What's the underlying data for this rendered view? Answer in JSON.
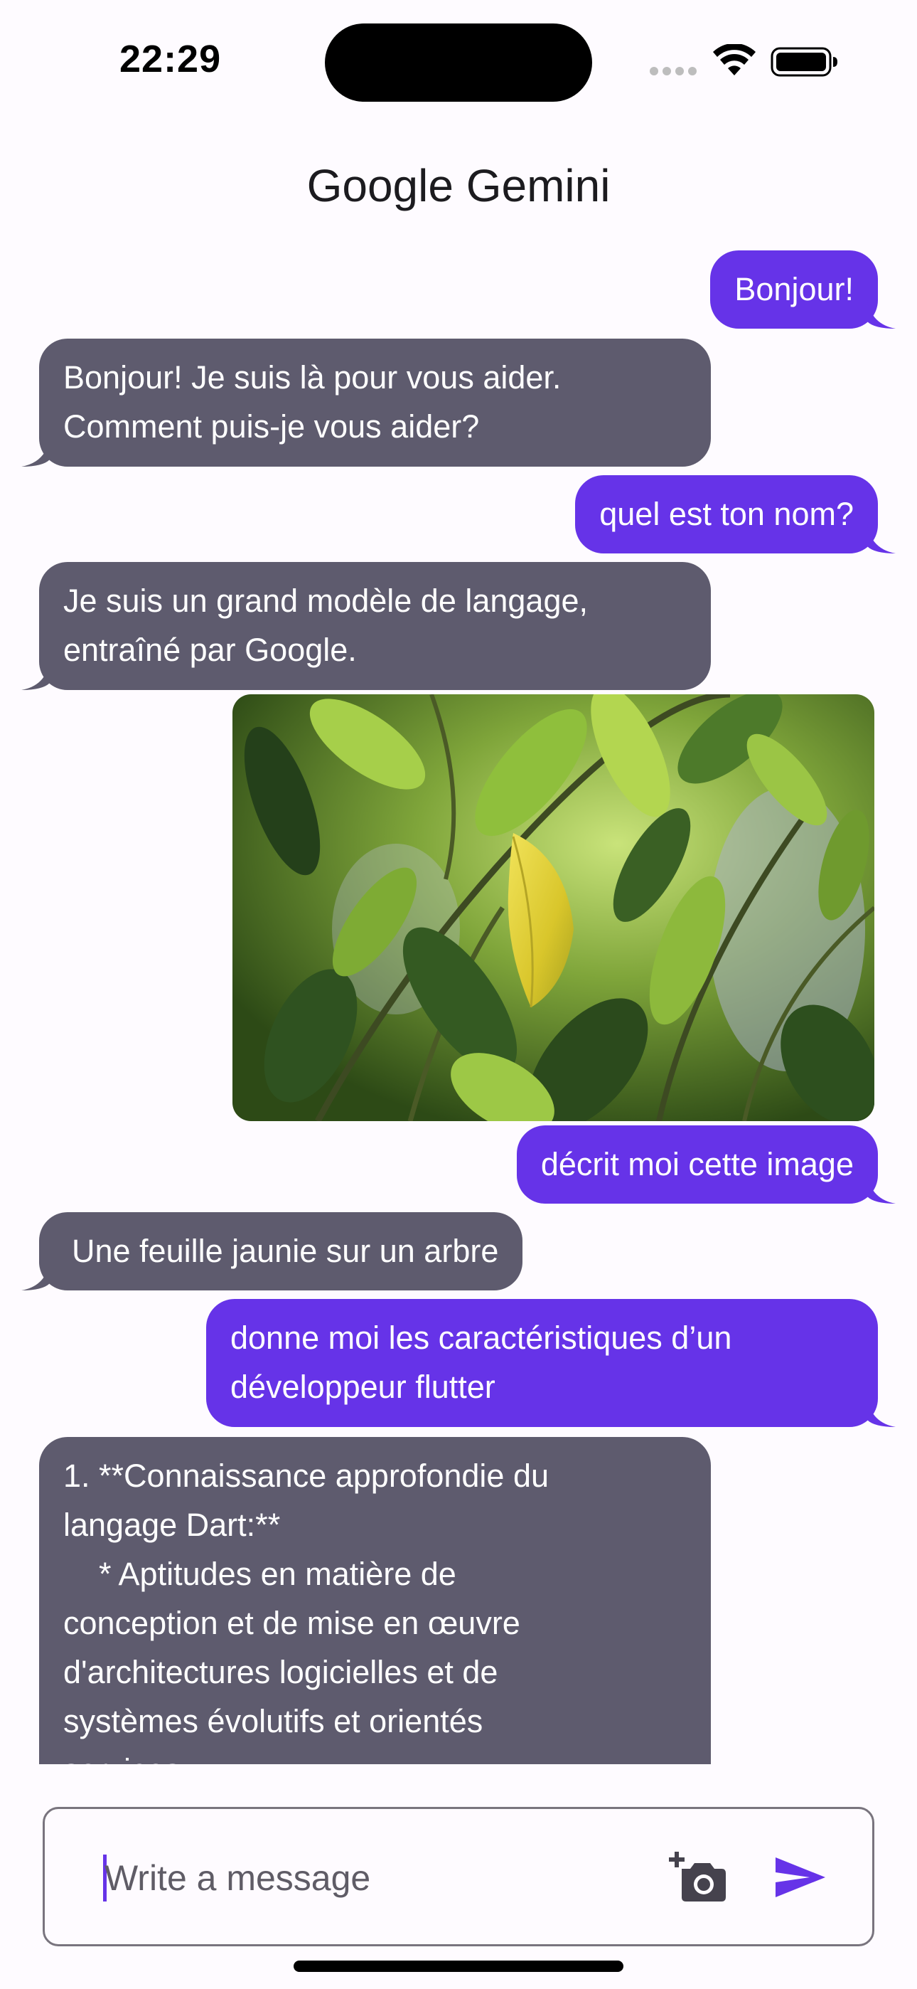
{
  "status_bar": {
    "time": "22:29"
  },
  "app_bar": {
    "title": "Google Gemini"
  },
  "colors": {
    "user_bubble": "#6633e8",
    "bot_bubble": "#5e5b6e",
    "background": "#fefbff",
    "accent": "#6633e8"
  },
  "messages": [
    {
      "role": "user",
      "text": "Bonjour!"
    },
    {
      "role": "bot",
      "text": "Bonjour! Je suis là pour vous aider.\nComment puis-je vous aider?"
    },
    {
      "role": "user",
      "text": "quel est ton nom?"
    },
    {
      "role": "bot",
      "text": "Je suis un grand modèle de langage,\nentraîné par Google."
    },
    {
      "role": "user",
      "type": "image"
    },
    {
      "role": "user",
      "text": "décrit moi cette image"
    },
    {
      "role": "bot",
      "text": "Une feuille jaunie sur un arbre"
    },
    {
      "role": "user",
      "text": "donne moi les caractéristiques d’un\ndéveloppeur flutter"
    },
    {
      "role": "bot",
      "text": "1. **Connaissance approfondie du\nlangage Dart:**\n    * Aptitudes en matière de\nconception et de mise en œuvre\nd'architectures logicielles et de\nsystèmes évolutifs et orientés\nservices."
    }
  ],
  "composer": {
    "placeholder": "Write a message",
    "value": "",
    "camera_icon": "add-photo-camera-icon",
    "send_icon": "send-icon"
  }
}
